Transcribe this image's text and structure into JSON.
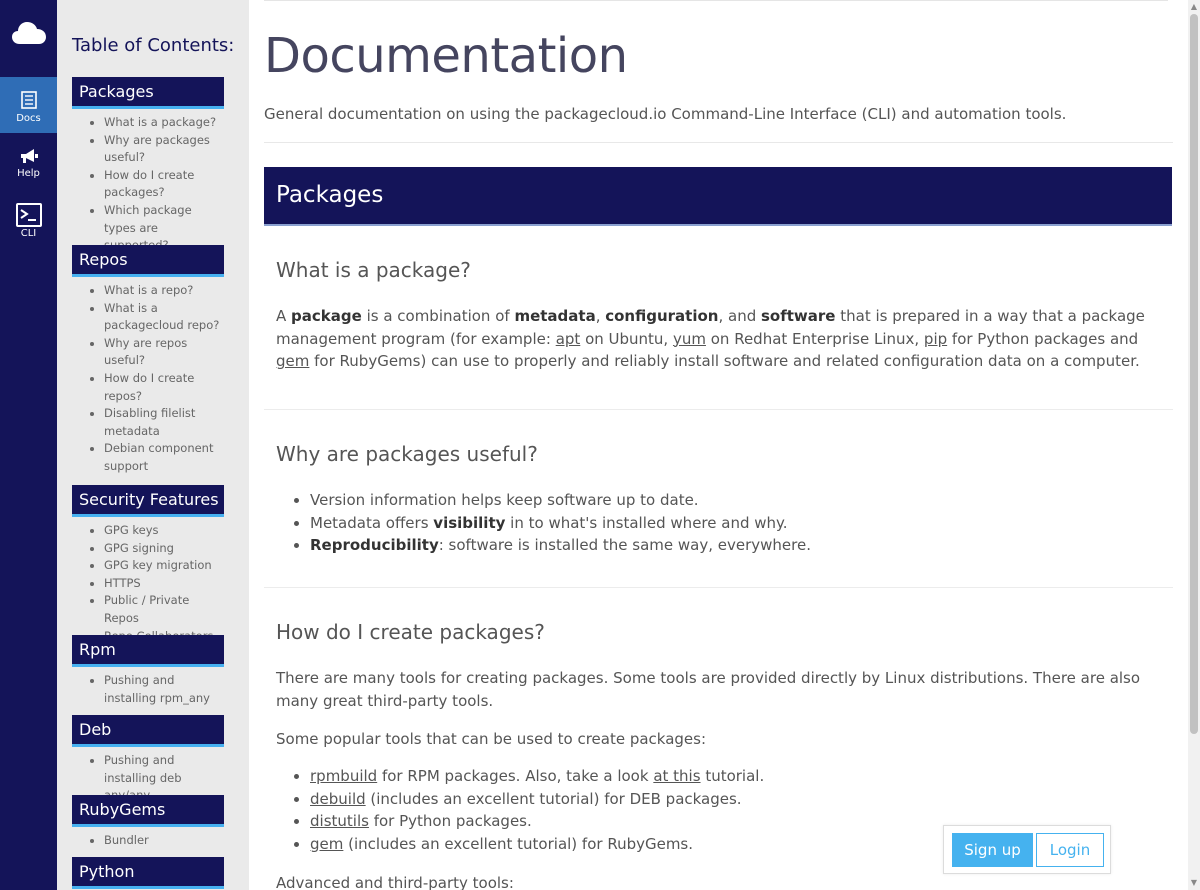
{
  "rail": {
    "items": [
      {
        "label": "Docs",
        "icon": "doc-icon"
      },
      {
        "label": "Help",
        "icon": "megaphone-icon"
      },
      {
        "label": "CLI",
        "icon": "terminal-icon"
      }
    ],
    "colors": {
      "bg": "#141459",
      "active": "#2f6db6"
    }
  },
  "toc": {
    "title": "Table of Contents:",
    "sections": [
      {
        "title": "Packages",
        "items": [
          "What is a package?",
          "Why are packages useful?",
          "How do I create packages?",
          "Which package types are supported?"
        ]
      },
      {
        "title": "Repos",
        "items": [
          "What is a repo?",
          "What is a packagecloud repo?",
          "Why are repos useful?",
          "How do I create repos?",
          "Disabling filelist metadata",
          "Debian component support"
        ]
      },
      {
        "title": "Security Features",
        "items": [
          "GPG keys",
          "GPG signing",
          "GPG key migration",
          "HTTPS",
          "Public / Private Repos",
          "Repo Collaborators"
        ]
      },
      {
        "title": "Rpm",
        "items": [
          "Pushing and installing rpm_any"
        ]
      },
      {
        "title": "Deb",
        "items": [
          "Pushing and installing deb any/any"
        ]
      },
      {
        "title": "RubyGems",
        "items": [
          "Bundler"
        ]
      },
      {
        "title": "Python",
        "items": []
      }
    ]
  },
  "main": {
    "title": "Documentation",
    "subtitle": "General documentation on using the packagecloud.io Command-Line Interface (CLI) and automation tools.",
    "section_title": "Packages",
    "what": {
      "heading": "What is a package?",
      "p": {
        "t1": "A ",
        "b1": "package",
        "t2": " is a combination of ",
        "b2": "metadata",
        "t3": ", ",
        "b3": "configuration",
        "t4": ", and ",
        "b4": "software",
        "t5": " that is prepared in a way that a package management program (for example: ",
        "l1": "apt",
        "t6": " on Ubuntu, ",
        "l2": "yum",
        "t7": " on Redhat Enterprise Linux, ",
        "l3": "pip",
        "t8": " for Python packages and ",
        "l4": "gem",
        "t9": " for RubyGems) can use to properly and reliably install software and related configuration data on a computer."
      }
    },
    "why": {
      "heading": "Why are packages useful?",
      "b1": "Version information helps keep software up to date.",
      "b2a": "Metadata offers ",
      "b2b": "visibility",
      "b2c": " in to what's installed where and why.",
      "b3a": "Reproducibility",
      "b3b": ": software is installed the same way, everywhere."
    },
    "how": {
      "heading": "How do I create packages?",
      "p1": "There are many tools for creating packages. Some tools are provided directly by Linux distributions. There are also many great third-party tools.",
      "p2": "Some popular tools that can be used to create packages:",
      "tools": [
        {
          "link": "rpmbuild",
          "rest": " for RPM packages. Also, take a look ",
          "link2": "at this",
          "rest2": " tutorial."
        },
        {
          "link": "debuild",
          "rest": " (includes an excellent tutorial) for DEB packages."
        },
        {
          "link": "distutils",
          "rest": " for Python packages."
        },
        {
          "link": "gem",
          "rest": " (includes an excellent tutorial) for RubyGems."
        }
      ],
      "p3": "Advanced and third-party tools:"
    }
  },
  "auth": {
    "signup": "Sign up",
    "login": "Login"
  }
}
